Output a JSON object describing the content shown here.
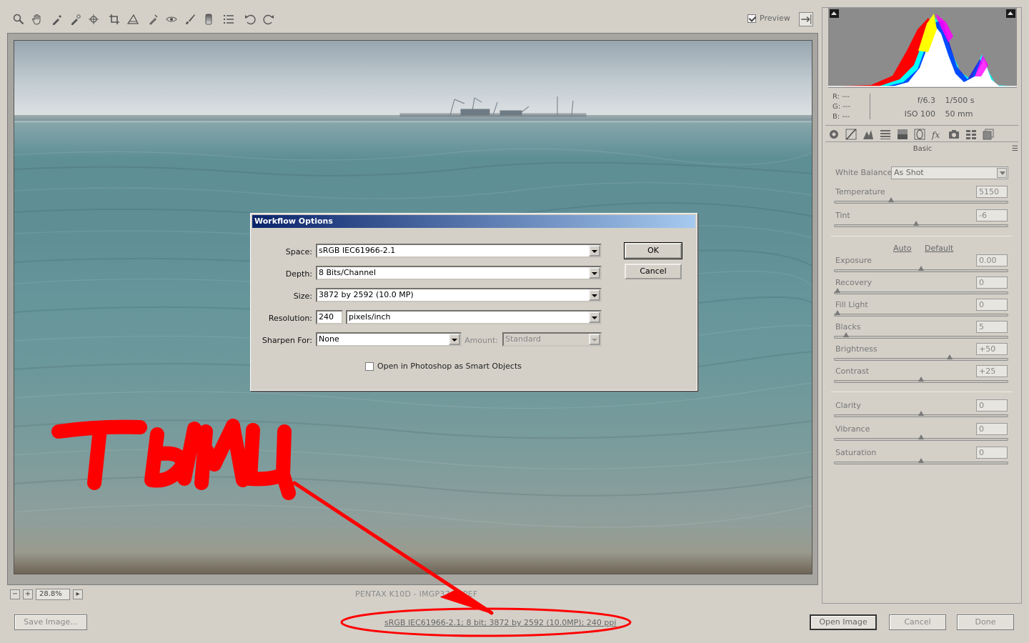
{
  "toolbar": {
    "tools": [
      "zoom-icon",
      "hand-icon",
      "white-balance-icon",
      "color-sampler-icon",
      "target-adjust-icon",
      "crop-icon",
      "straighten-icon",
      "retouch-icon",
      "red-eye-icon",
      "adjustment-brush-icon",
      "graduated-filter-icon",
      "preferences-icon",
      "rotate-left-icon",
      "rotate-right-icon"
    ],
    "preview_label": "Preview",
    "preview_checked": true
  },
  "zoom": {
    "minus": "−",
    "plus": "+",
    "value": "28.8%",
    "menu": "▸"
  },
  "file_caption": "PENTAX K10D  -  IMGP3743.PEF",
  "right_panel": {
    "readout": {
      "r": "R:  ---",
      "g": "G:  ---",
      "b": "B:  ---"
    },
    "exif": {
      "aperture": "f/6.3",
      "shutter": "1/500 s",
      "iso": "ISO 100",
      "focal": "50 mm"
    },
    "tabs": [
      "basic-tab-icon",
      "tone-curve-tab-icon",
      "detail-tab-icon",
      "hsl-tab-icon",
      "split-toning-tab-icon",
      "lens-corrections-tab-icon",
      "effects-tab-icon",
      "camera-calibration-tab-icon",
      "presets-tab-icon",
      "snapshots-tab-icon"
    ],
    "panel_title": "Basic",
    "panel_menu": "☰",
    "white_balance": {
      "label": "White Balance:",
      "value": "As Shot"
    },
    "temperature": {
      "label": "Temperature",
      "value": "5150",
      "level": 0.32
    },
    "tint": {
      "label": "Tint",
      "value": "-6",
      "level": 0.47
    },
    "auto": "Auto",
    "default": "Default",
    "exposure": {
      "label": "Exposure",
      "value": "0.00",
      "level": 0.5
    },
    "recovery": {
      "label": "Recovery",
      "value": "0",
      "level": 0.0
    },
    "fill_light": {
      "label": "Fill Light",
      "value": "0",
      "level": 0.0
    },
    "blacks": {
      "label": "Blacks",
      "value": "5",
      "level": 0.05
    },
    "brightness": {
      "label": "Brightness",
      "value": "+50",
      "level": 0.67
    },
    "contrast": {
      "label": "Contrast",
      "value": "+25",
      "level": 0.5
    },
    "clarity": {
      "label": "Clarity",
      "value": "0",
      "level": 0.5
    },
    "vibrance": {
      "label": "Vibrance",
      "value": "0",
      "level": 0.5
    },
    "saturation": {
      "label": "Saturation",
      "value": "0",
      "level": 0.5
    }
  },
  "bottom_bar": {
    "save_image": "Save Image...",
    "workflow_link": "sRGB IEC61966-2.1; 8 bit; 3872 by 2592 (10.0MP); 240 ppi",
    "open_image": "Open Image",
    "cancel": "Cancel",
    "done": "Done"
  },
  "dialog": {
    "title": "Workflow Options",
    "space_label": "Space:",
    "space_value": "sRGB IEC61966-2.1",
    "depth_label": "Depth:",
    "depth_value": "8 Bits/Channel",
    "size_label": "Size:",
    "size_value": "3872 by 2592  (10.0 MP)",
    "resolution_label": "Resolution:",
    "resolution_value": "240",
    "resolution_unit": "pixels/inch",
    "sharpen_label": "Sharpen For:",
    "sharpen_value": "None",
    "amount_label": "Amount:",
    "amount_value": "Standard",
    "smart_objects_label": "Open in Photoshop as Smart Objects",
    "smart_objects_checked": false,
    "ok": "OK",
    "cancel": "Cancel"
  },
  "annotation": {
    "text": "тымц",
    "color": "#ff0000"
  }
}
